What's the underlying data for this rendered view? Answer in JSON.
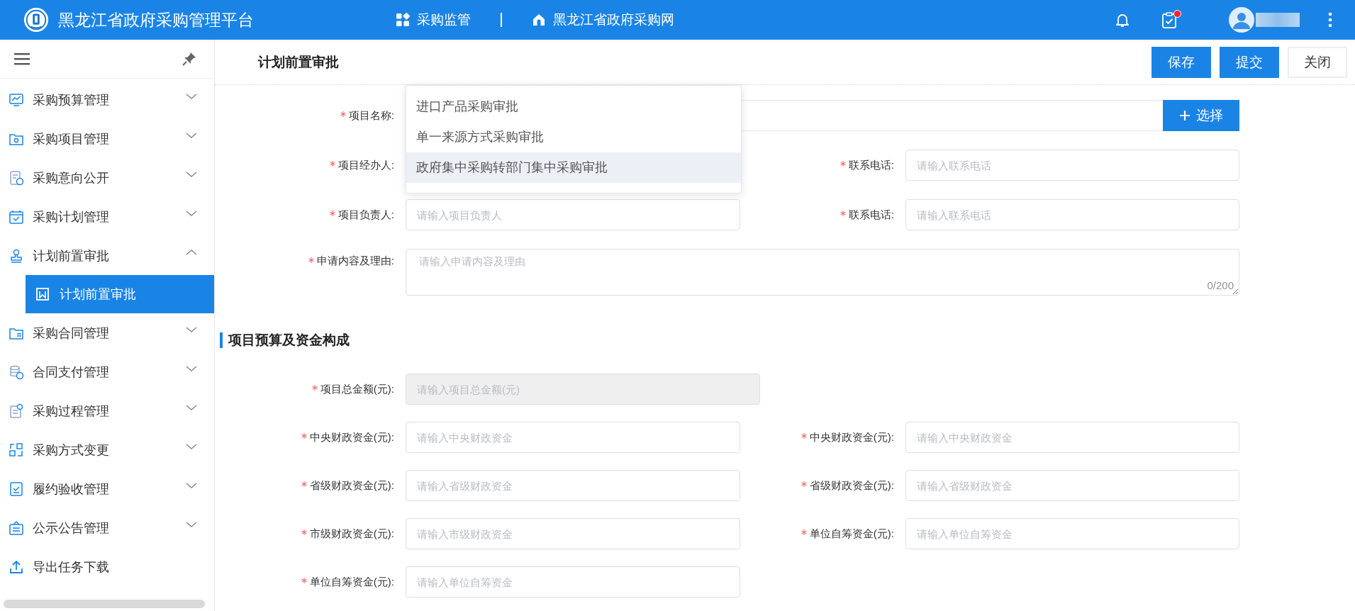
{
  "header": {
    "title": "黑龙江省政府采购管理平台",
    "nav": [
      {
        "kind": "grid",
        "label": "采购监管"
      },
      {
        "kind": "home",
        "label": "黑龙江省政府采购网"
      }
    ],
    "notifications": {
      "unread": true
    }
  },
  "sidebar": {
    "items": [
      {
        "label": "采购预算管理",
        "expanded": false
      },
      {
        "label": "采购项目管理",
        "expanded": false
      },
      {
        "label": "采购意向公开",
        "expanded": false
      },
      {
        "label": "采购计划管理",
        "expanded": false
      },
      {
        "label": "计划前置审批",
        "expanded": true,
        "children": [
          {
            "label": "计划前置审批",
            "selected": true
          }
        ]
      },
      {
        "label": "采购合同管理",
        "expanded": false
      },
      {
        "label": "合同支付管理",
        "expanded": false
      },
      {
        "label": "采购过程管理",
        "expanded": false
      },
      {
        "label": "采购方式变更",
        "expanded": false
      },
      {
        "label": "履约验收管理",
        "expanded": false
      },
      {
        "label": "公示公告管理",
        "expanded": false
      },
      {
        "label": "导出任务下载"
      }
    ]
  },
  "page": {
    "title": "计划前置审批",
    "buttons": [
      {
        "label": "保存",
        "primary": true
      },
      {
        "label": "提交",
        "primary": true
      },
      {
        "label": "关闭",
        "primary": false
      }
    ]
  },
  "form": {
    "rows": [
      {
        "kind": "picker",
        "fields": [
          {
            "label": "项目名称:",
            "required": true,
            "button": "选择"
          }
        ]
      },
      {
        "kind": "pair",
        "fields": [
          {
            "label": "项目经办人:",
            "required": true
          },
          {
            "label": "联系电话:",
            "required": true,
            "placeholder": "请输入联系电话"
          }
        ]
      },
      {
        "kind": "pair",
        "fields": [
          {
            "label": "项目负责人:",
            "required": true,
            "placeholder": "请输入项目负责人"
          },
          {
            "label": "联系电话:",
            "required": true,
            "placeholder": "请输入联系电话"
          }
        ]
      },
      {
        "kind": "textarea",
        "fields": [
          {
            "label": "申请内容及理由:",
            "required": true,
            "placeholder": "请输入申请内容及理由",
            "counter": "0/200"
          }
        ]
      }
    ]
  },
  "dropdown": {
    "options": [
      {
        "label": "进口产品采购审批",
        "highlighted": false
      },
      {
        "label": "单一来源方式采购审批",
        "highlighted": false
      },
      {
        "label": "政府集中采购转部门集中采购审批",
        "highlighted": true
      }
    ]
  },
  "budget": {
    "title": "项目预算及资金构成",
    "rows": [
      {
        "kind": "single",
        "fields": [
          {
            "label": "项目总金额(元):",
            "required": true,
            "placeholder": "请输入项目总金额(元)",
            "disabled": true
          }
        ]
      },
      {
        "kind": "pair",
        "fields": [
          {
            "label": "中央财政资金(元):",
            "required": true,
            "placeholder": "请输入中央财政资金",
            "disabled": false
          },
          {
            "label": "中央财政资金(元):",
            "required": true,
            "placeholder": "请输入中央财政资金",
            "disabled": false
          }
        ]
      },
      {
        "kind": "pair",
        "fields": [
          {
            "label": "省级财政资金(元):",
            "required": true,
            "placeholder": "请输入省级财政资金",
            "disabled": false
          },
          {
            "label": "省级财政资金(元):",
            "required": true,
            "placeholder": "请输入省级财政资金",
            "disabled": false
          }
        ]
      },
      {
        "kind": "pair",
        "fields": [
          {
            "label": "市级财政资金(元):",
            "required": true,
            "placeholder": "请输入市级财政资金",
            "disabled": false
          },
          {
            "label": "单位自筹资金(元):",
            "required": true,
            "placeholder": "请输入单位自筹资金",
            "disabled": false
          }
        ]
      },
      {
        "kind": "single",
        "fields": [
          {
            "label": "单位自筹资金(元):",
            "required": true,
            "placeholder": "请输入单位自筹资金",
            "disabled": false
          }
        ]
      }
    ]
  }
}
